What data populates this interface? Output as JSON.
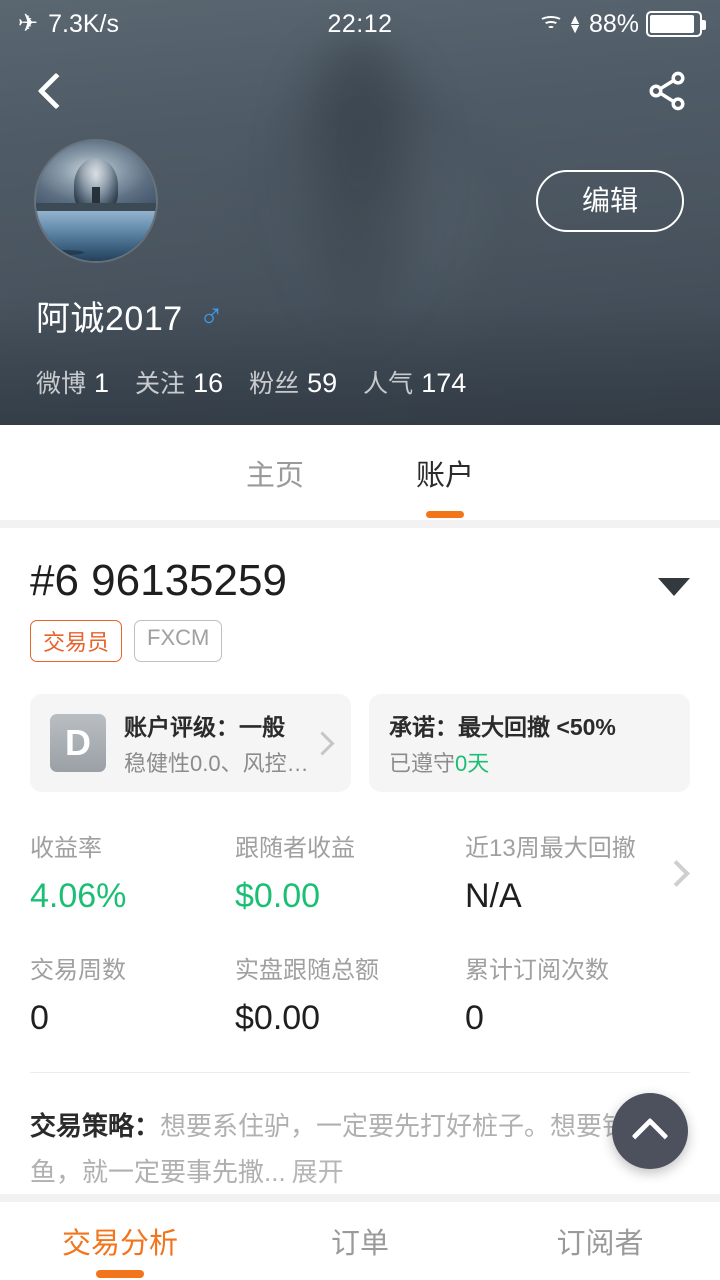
{
  "statusbar": {
    "plane_icon": "airplane-mode-icon",
    "network_speed": "7.3K/s",
    "time": "22:12",
    "wifi_icon": "wifi-icon",
    "battery_percent": "88%"
  },
  "nav": {
    "back_icon": "back-chevron-icon",
    "share_icon": "share-icon"
  },
  "profile": {
    "edit_label": "编辑",
    "username": "阿诚2017",
    "gender_symbol": "♂",
    "stats": [
      {
        "label": "微博",
        "value": "1"
      },
      {
        "label": "关注",
        "value": "16"
      },
      {
        "label": "粉丝",
        "value": "59"
      },
      {
        "label": "人气",
        "value": "174"
      }
    ]
  },
  "top_tabs": [
    {
      "label": "主页",
      "active": false
    },
    {
      "label": "账户",
      "active": true
    }
  ],
  "account": {
    "id": "#6 96135259",
    "caret_icon": "chevron-down-icon",
    "badges": [
      {
        "label": "交易员",
        "style": "orange"
      },
      {
        "label": "FXCM",
        "style": "gray"
      }
    ],
    "rating_card": {
      "grade": "D",
      "title": "账户评级：一般",
      "subtitle": "稳健性0.0、风控…",
      "chevron_icon": "chevron-right-icon"
    },
    "promise_card": {
      "title": "承诺：最大回撤 <50%",
      "sub_prefix": "已遵守",
      "sub_value": "0天"
    },
    "metrics": [
      {
        "label": "收益率",
        "value": "4.06%",
        "color": "green"
      },
      {
        "label": "跟随者收益",
        "value": "$0.00",
        "color": "green"
      },
      {
        "label": "近13周最大回撤",
        "value": "N/A",
        "color": "dark"
      },
      {
        "label": "交易周数",
        "value": "0",
        "color": "dark"
      },
      {
        "label": "实盘跟随总额",
        "value": "$0.00",
        "color": "dark"
      },
      {
        "label": "累计订阅次数",
        "value": "0",
        "color": "dark"
      }
    ],
    "metrics_chevron_icon": "chevron-right-icon",
    "strategy": {
      "label": "交易策略：",
      "text": "想要系住驴，一定要先打好桩子。想要钓到鱼，就一定要事先撒...",
      "expand_label": "展开"
    }
  },
  "fab": {
    "icon": "chevron-up-icon"
  },
  "bottom_tabs": [
    {
      "label": "交易分析",
      "active": true
    },
    {
      "label": "订单",
      "active": false
    },
    {
      "label": "订阅者",
      "active": false
    }
  ],
  "colors": {
    "accent_orange": "#f2741b",
    "badge_orange": "#e8622b",
    "green": "#1bbf74",
    "header_dark": "#4a5560"
  }
}
